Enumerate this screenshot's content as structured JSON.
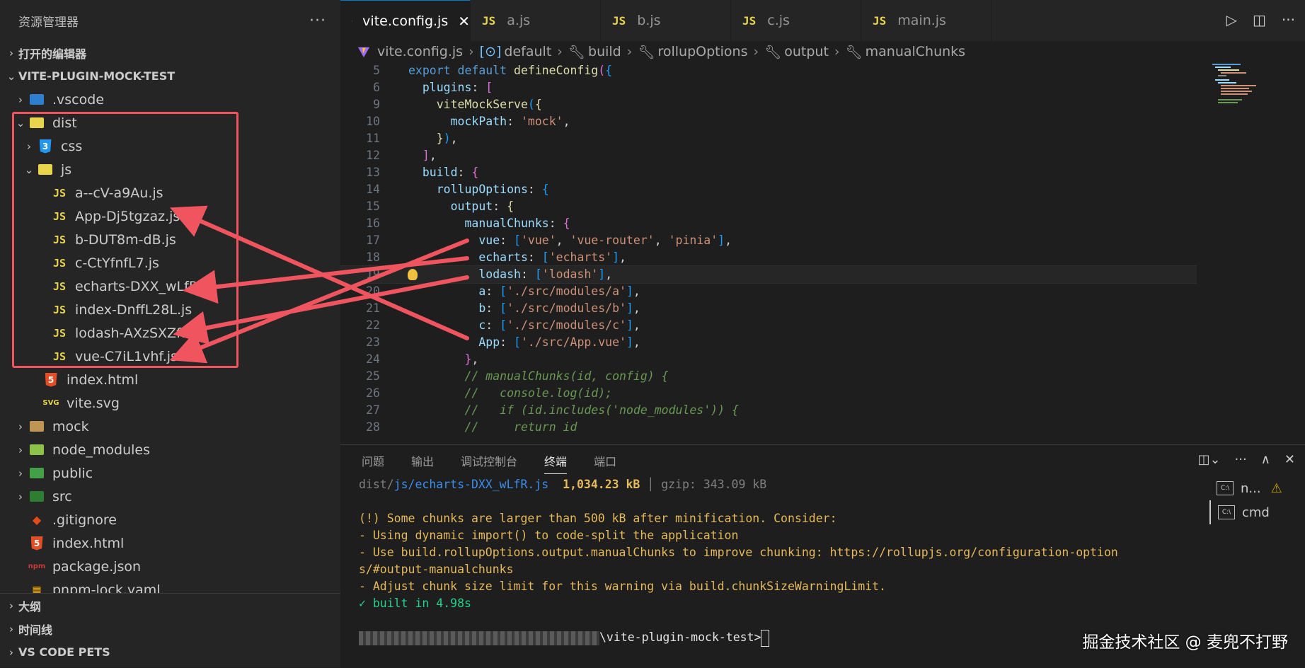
{
  "sidebar": {
    "title": "资源管理器",
    "more": "···",
    "open_editors": "打开的编辑器",
    "project": "VITE-PLUGIN-MOCK-TEST",
    "tree": [
      {
        "label": ".vscode"
      },
      {
        "label": "dist"
      },
      {
        "label": "css"
      },
      {
        "label": "js"
      },
      {
        "label": "a--cV-a9Au.js"
      },
      {
        "label": "App-Dj5tgzaz.js"
      },
      {
        "label": "b-DUT8m-dB.js"
      },
      {
        "label": "c-CtYfnfL7.js"
      },
      {
        "label": "echarts-DXX_wLfR.js"
      },
      {
        "label": "index-DnffL28L.js"
      },
      {
        "label": "lodash-AXzSXZf1.js"
      },
      {
        "label": "vue-C7iL1vhf.js"
      },
      {
        "label": "index.html"
      },
      {
        "label": "vite.svg"
      },
      {
        "label": "mock"
      },
      {
        "label": "node_modules"
      },
      {
        "label": "public"
      },
      {
        "label": "src"
      },
      {
        "label": ".gitignore"
      },
      {
        "label": "index.html"
      },
      {
        "label": "package.json"
      },
      {
        "label": "pnpm-lock.yaml"
      }
    ],
    "bottom_sections": [
      "大纲",
      "时间线",
      "VS CODE PETS"
    ]
  },
  "tabs": [
    {
      "label": "vite.config.js",
      "active": true
    },
    {
      "label": "a.js"
    },
    {
      "label": "b.js"
    },
    {
      "label": "c.js"
    },
    {
      "label": "main.js"
    }
  ],
  "tab_icon_label": "JS",
  "breadcrumb": [
    "vite.config.js",
    "default",
    "build",
    "rollupOptions",
    "output",
    "manualChunks"
  ],
  "code": {
    "line_numbers": [
      "5",
      "6",
      "9",
      "10",
      "11",
      "12",
      "13",
      "14",
      "15",
      "16",
      "17",
      "18",
      "19",
      "20",
      "21",
      "22",
      "23",
      "24",
      "25",
      "26",
      "27",
      "28"
    ]
  },
  "panel": {
    "tabs": [
      "问题",
      "输出",
      "调试控制台",
      "终端",
      "端口"
    ],
    "active_tab": "终端",
    "terminal": {
      "line1_path_dim": "dist/",
      "line1_path_blue": "js/echarts-DXX_wLfR.js",
      "line1_size": "1,034.23 kB",
      "line1_sep": "│",
      "line1_gzip": "gzip: 343.09 kB",
      "warn1": "(!) Some chunks are larger than 500 kB after minification. Consider:",
      "warn2": "- Using dynamic import() to code-split the application",
      "warn3": "- Use build.rollupOptions.output.manualChunks to improve chunking: https://rollupjs.org/configuration-option",
      "warn4": "s/#output-manualchunks",
      "warn5": "- Adjust chunk size limit for this warning via build.chunkSizeWarningLimit.",
      "built": "✓ built in 4.98s",
      "prompt": "\\vite-plugin-mock-test>"
    },
    "terminals": [
      {
        "label": "n...",
        "warn": "⚠"
      },
      {
        "label": "cmd"
      }
    ]
  },
  "watermark": "掘金技术社区 @ 麦兜不打野",
  "colors": {
    "accent": "#007acc",
    "annotation": "#f0555f",
    "js": "#e8d44d"
  }
}
